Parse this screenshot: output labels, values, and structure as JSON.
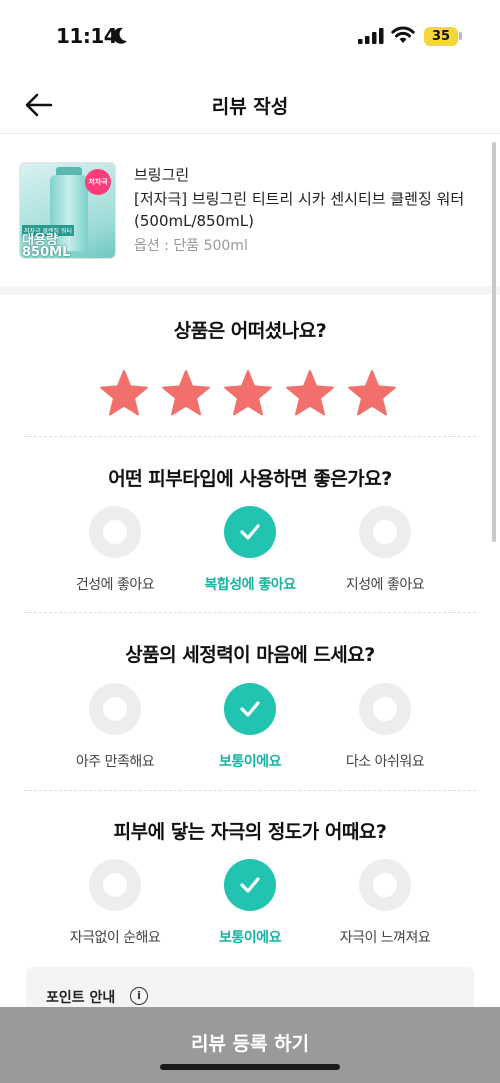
{
  "status_bar": {
    "time": "11:14",
    "battery": "35"
  },
  "header": {
    "title": "리뷰 작성"
  },
  "product": {
    "brand": "브링그린",
    "name": "[저자극] 브링그린 티트리 시카 센시티브 클렌징 워터 (500mL/850mL)",
    "option": "옵션 : 단품 500ml",
    "thumbnail": {
      "badge": "저자극",
      "tag": "저자극 클렌징 워터",
      "promo_line1": "대용량",
      "promo_line2": "850ML"
    }
  },
  "rating": {
    "question": "상품은 어떠셨나요?",
    "stars": 5,
    "max": 5,
    "star_color": "#f2706b"
  },
  "questions": [
    {
      "question": "어떤 피부타입에 사용하면 좋은가요?",
      "options": [
        {
          "label": "건성에 좋아요",
          "selected": false
        },
        {
          "label": "복합성에 좋아요",
          "selected": true
        },
        {
          "label": "지성에 좋아요",
          "selected": false
        }
      ]
    },
    {
      "question": "상품의 세정력이 마음에 드세요?",
      "options": [
        {
          "label": "아주 만족해요",
          "selected": false
        },
        {
          "label": "보통이에요",
          "selected": true
        },
        {
          "label": "다소 아쉬워요",
          "selected": false
        }
      ]
    },
    {
      "question": "피부에 닿는 자극의 정도가 어때요?",
      "options": [
        {
          "label": "자극없이 순해요",
          "selected": false
        },
        {
          "label": "보통이에요",
          "selected": true
        },
        {
          "label": "자극이 느껴져요",
          "selected": false
        }
      ]
    }
  ],
  "points_info": {
    "title": "포인트 안내",
    "icon": "info-icon"
  },
  "submit": {
    "label": "리뷰 등록 하기"
  },
  "colors": {
    "accent": "#22c3b1",
    "accent_text": "#17b3a1",
    "submit_bg": "#9a9a9a"
  }
}
